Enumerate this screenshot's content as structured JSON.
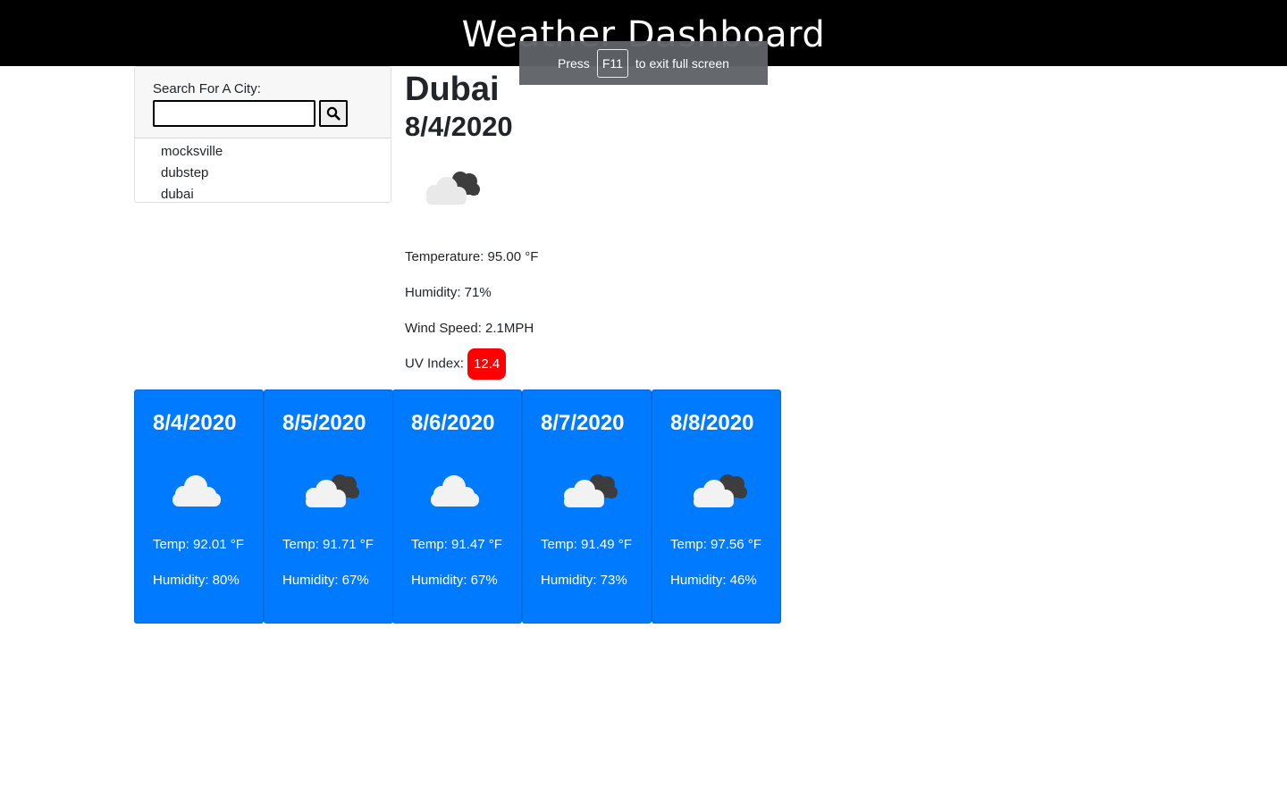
{
  "header": {
    "title": "Weather Dashboard"
  },
  "fullscreen_notice": {
    "prefix": "Press",
    "key": "F11",
    "suffix": "to exit full screen"
  },
  "search": {
    "label": "Search For A City:",
    "value": "",
    "button_icon": "search-icon",
    "history": [
      "mocksville",
      "dubstep",
      "dubai"
    ]
  },
  "current": {
    "city": "Dubai",
    "date": "8/4/2020",
    "icon": "broken-clouds-icon",
    "temperature": "Temperature: 95.00 °F",
    "humidity": "Humidity: 71%",
    "wind": "Wind Speed: 2.1MPH",
    "uv_label": "UV Index:",
    "uv_value": "12.4",
    "uv_color": "#ff0000"
  },
  "forecast": [
    {
      "date": "8/4/2020",
      "icon": "cloud-icon",
      "temp": "Temp: 92.01 °F",
      "humidity": "Humidity: 80%"
    },
    {
      "date": "8/5/2020",
      "icon": "broken-clouds-icon",
      "temp": "Temp: 91.71 °F",
      "humidity": "Humidity: 67%"
    },
    {
      "date": "8/6/2020",
      "icon": "cloud-icon",
      "temp": "Temp: 91.47 °F",
      "humidity": "Humidity: 67%"
    },
    {
      "date": "8/7/2020",
      "icon": "broken-clouds-icon",
      "temp": "Temp: 91.49 °F",
      "humidity": "Humidity: 73%"
    },
    {
      "date": "8/8/2020",
      "icon": "broken-clouds-icon",
      "temp": "Temp: 97.56 °F",
      "humidity": "Humidity: 46%"
    }
  ],
  "colors": {
    "header_bg": "#000000",
    "forecast_bg": "#007bff",
    "uv_high": "#ff0000"
  }
}
